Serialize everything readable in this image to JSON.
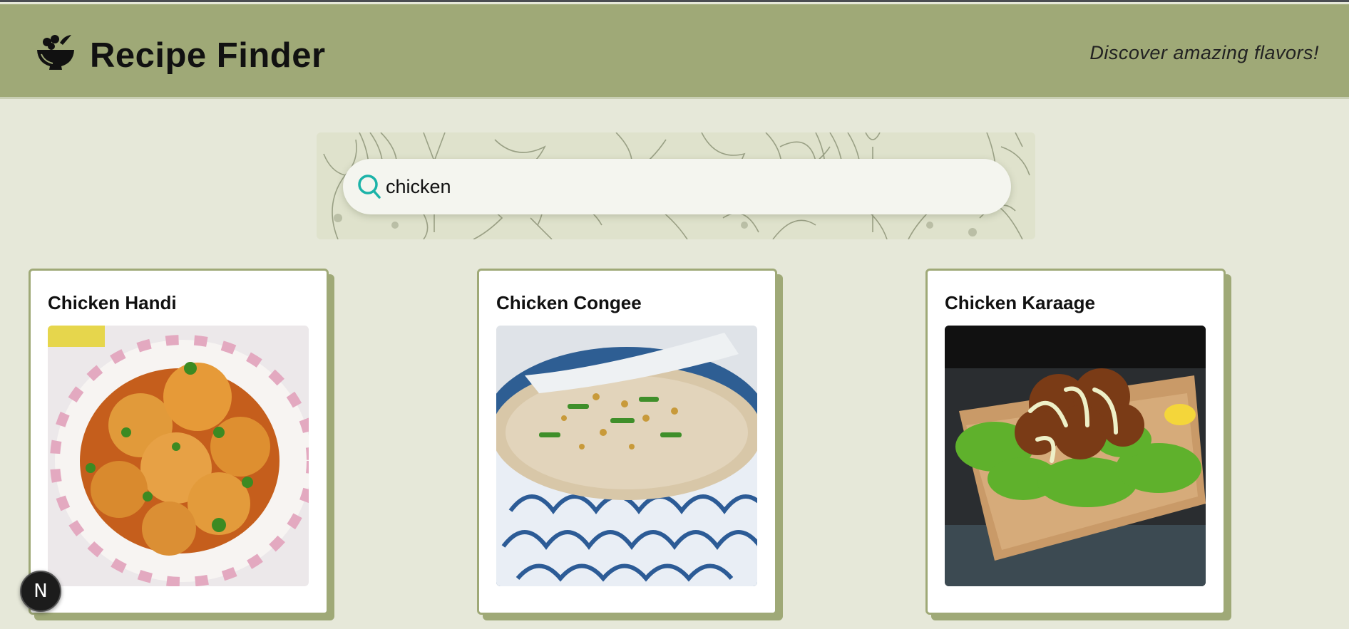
{
  "header": {
    "title": "Recipe Finder",
    "tagline": "Discover amazing flavors!",
    "logo_icon": "mortar-bowl-icon"
  },
  "search": {
    "value": "chicken",
    "icon": "search-icon"
  },
  "recipes": [
    {
      "title": "Chicken Handi",
      "image": "chicken-handi-photo"
    },
    {
      "title": "Chicken Congee",
      "image": "chicken-congee-photo"
    },
    {
      "title": "Chicken Karaage",
      "image": "chicken-karaage-photo"
    }
  ],
  "dev_badge": {
    "label": "N"
  },
  "colors": {
    "header_bg": "#9fa977",
    "page_bg": "#e6e8d9",
    "accent": "#1bb3a8"
  }
}
